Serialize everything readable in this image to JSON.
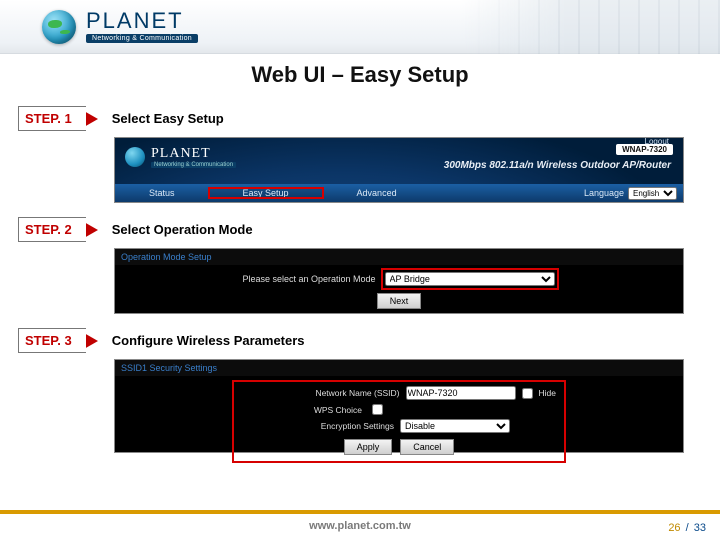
{
  "brand": {
    "name": "PLANET",
    "tagline": "Networking & Communication"
  },
  "slide": {
    "title": "Web UI – Easy Setup"
  },
  "steps": [
    {
      "label": "STEP. 1",
      "title": "Select Easy Setup"
    },
    {
      "label": "STEP. 2",
      "title": "Select Operation Mode"
    },
    {
      "label": "STEP. 3",
      "title": "Configure Wireless Parameters"
    }
  ],
  "shot1": {
    "brand_name": "PLANET",
    "brand_tag": "Networking & Communication",
    "model": "WNAP-7320",
    "logout": "Logout",
    "product_line": "300Mbps 802.11a/n Wireless Outdoor AP/Router",
    "nav": {
      "status": "Status",
      "easy_setup": "Easy Setup",
      "advanced": "Advanced",
      "language_label": "Language",
      "language_value": "English"
    }
  },
  "shot2": {
    "header": "Operation Mode Setup",
    "prompt": "Please select an Operation Mode",
    "mode_value": "AP Bridge",
    "next": "Next"
  },
  "shot3": {
    "header": "SSID1 Security Settings",
    "fields": {
      "ssid_label": "Network Name (SSID)",
      "ssid_value": "WNAP-7320",
      "hide_label": "Hide",
      "wps_label": "WPS Choice",
      "enc_label": "Encryption Settings",
      "enc_value": "Disable",
      "apply": "Apply",
      "cancel": "Cancel"
    }
  },
  "footer": {
    "url": "www.planet.com.tw",
    "page_current": "26",
    "page_sep": "/",
    "page_total": "33"
  }
}
